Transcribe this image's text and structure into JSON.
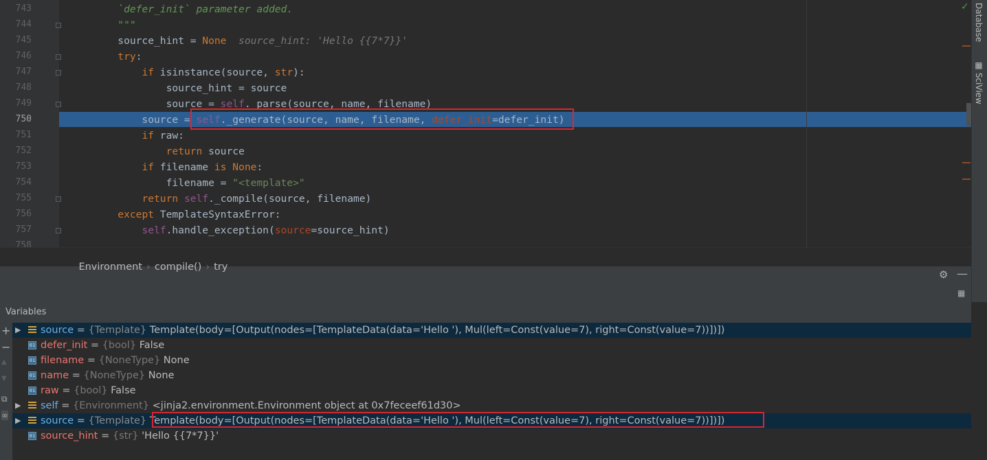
{
  "editor": {
    "current_line": 750,
    "lines": [
      {
        "n": 743,
        "html": "        <span class='doc'>`defer_init` parameter added.</span>"
      },
      {
        "n": 744,
        "html": "        <span class='doc'>\"\"\"</span>"
      },
      {
        "n": 745,
        "html": "        source_hint = <span class='kw'>None</span>  <span class='hint'>source_hint: 'Hello {{7*7}}'</span>"
      },
      {
        "n": 746,
        "html": "        <span class='kw'>try</span>:"
      },
      {
        "n": 747,
        "html": "            <span class='kw'>if</span> isinstance(source, <span class='kw'>str</span>):"
      },
      {
        "n": 748,
        "html": "                source_hint = source"
      },
      {
        "n": 749,
        "html": "                source = <span class='slf'>self</span>._parse(source, name, filename)"
      },
      {
        "n": 750,
        "html": "            source = <span class='slf'>self</span>._generate(source, name, filename, <span class='prm'>defer_init</span>=defer_init)"
      },
      {
        "n": 751,
        "html": "            <span class='kw'>if</span> raw:"
      },
      {
        "n": 752,
        "html": "                <span class='kw'>return</span> source"
      },
      {
        "n": 753,
        "html": "            <span class='kw'>if</span> filename <span class='kw'>is None</span>:"
      },
      {
        "n": 754,
        "html": "                filename = <span class='str'>\"&lt;template&gt;\"</span>"
      },
      {
        "n": 755,
        "html": "            <span class='kw'>return</span> <span class='slf'>self</span>._compile(source, filename)"
      },
      {
        "n": 756,
        "html": "        <span class='kw'>except</span> TemplateSyntaxError:"
      },
      {
        "n": 757,
        "html": "            <span class='slf'>self</span>.handle_exception(<span class='prm'>source</span>=source_hint)"
      },
      {
        "n": 758,
        "html": ""
      }
    ]
  },
  "breadcrumb": [
    "Environment",
    "compile()",
    "try"
  ],
  "side_tabs": [
    "Database",
    "SciView"
  ],
  "panel": {
    "variables_label": "Variables",
    "gear_icon": "gear-icon",
    "minimize_icon": "minimize-icon"
  },
  "variables": [
    {
      "name": "source",
      "type": "{Template}",
      "value": "Template(body=[Output(nodes=[TemplateData(data='Hello '), Mul(left=Const(value=7), right=Const(value=7))])])",
      "expandable": true,
      "icon": "object",
      "selected": true,
      "blue": true
    },
    {
      "name": "defer_init",
      "type": "{bool}",
      "value": "False",
      "expandable": false,
      "icon": "primitive",
      "selected": false,
      "blue": false
    },
    {
      "name": "filename",
      "type": "{NoneType}",
      "value": "None",
      "expandable": false,
      "icon": "primitive",
      "selected": false,
      "blue": false
    },
    {
      "name": "name",
      "type": "{NoneType}",
      "value": "None",
      "expandable": false,
      "icon": "primitive",
      "selected": false,
      "blue": false
    },
    {
      "name": "raw",
      "type": "{bool}",
      "value": "False",
      "expandable": false,
      "icon": "primitive",
      "selected": false,
      "blue": false
    },
    {
      "name": "self",
      "type": "{Environment}",
      "value": "<jinja2.environment.Environment object at 0x7feceef61d30>",
      "expandable": true,
      "icon": "object",
      "selected": false,
      "blue": true
    },
    {
      "name": "source",
      "type": "{Template}",
      "value": "Template(body=[Output(nodes=[TemplateData(data='Hello '), Mul(left=Const(value=7), right=Const(value=7))])])",
      "expandable": true,
      "icon": "object",
      "selected": true,
      "blue": true
    },
    {
      "name": "source_hint",
      "type": "{str}",
      "value": "'Hello {{7*7}}'",
      "expandable": false,
      "icon": "primitive",
      "selected": false,
      "blue": false
    }
  ]
}
